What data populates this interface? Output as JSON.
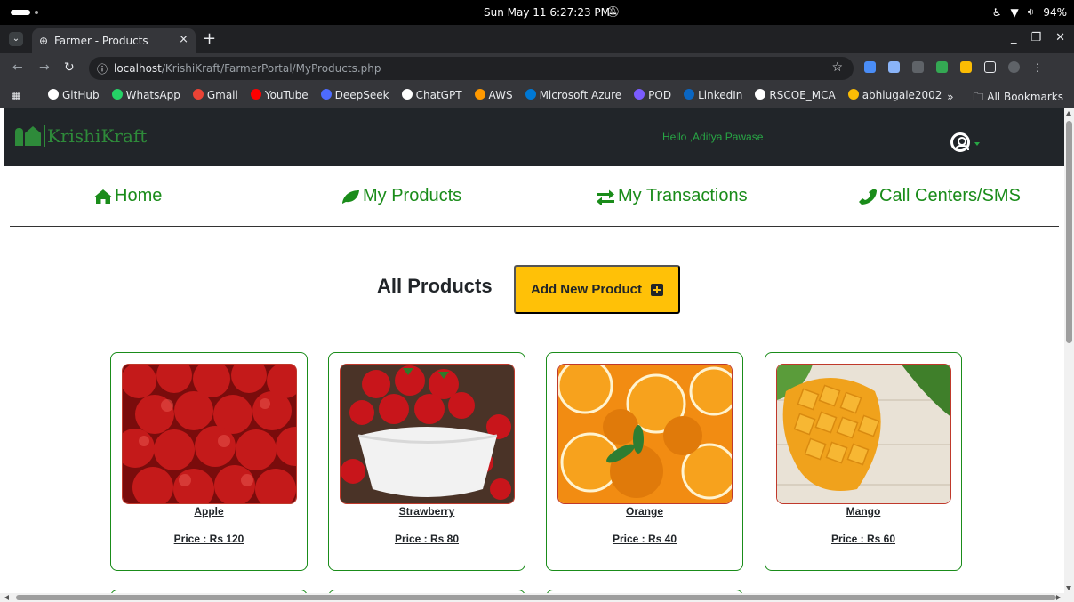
{
  "os": {
    "datetime": "Sun May 11   6:27:23 PM",
    "battery": "94%"
  },
  "browser": {
    "tab_title": "Farmer - Products",
    "tab_close": "×",
    "new_tab": "+",
    "url_host": "localhost",
    "url_path": "/KrishiKraft/FarmerPortal/MyProducts.php",
    "bookmarks": [
      {
        "label": "GitHub",
        "color": "#ffffff"
      },
      {
        "label": "WhatsApp",
        "color": "#25d366"
      },
      {
        "label": "Gmail",
        "color": "#ea4335"
      },
      {
        "label": "YouTube",
        "color": "#ff0000"
      },
      {
        "label": "DeepSeek",
        "color": "#4d6bfe"
      },
      {
        "label": "ChatGPT",
        "color": "#ffffff"
      },
      {
        "label": "AWS",
        "color": "#ff9900"
      },
      {
        "label": "Microsoft Azure",
        "color": "#0078d4"
      },
      {
        "label": "POD",
        "color": "#7b5cff"
      },
      {
        "label": "LinkedIn",
        "color": "#0a66c2"
      },
      {
        "label": "RSCOE_MCA",
        "color": "#ffffff"
      },
      {
        "label": "abhiugale2002",
        "color": "#fbbc04"
      }
    ],
    "bookmarks_overflow": "»",
    "all_bookmarks": "All Bookmarks"
  },
  "site": {
    "logo_text": "KrishiKraft",
    "greeting": "Hello ,Aditya Pawase",
    "accent": "#1a8c1a",
    "header_bg": "#212529"
  },
  "nav": {
    "home": "Home",
    "products": "My Products",
    "transactions": "My Transactions",
    "call_centers": "Call Centers/SMS"
  },
  "main": {
    "title": "All Products",
    "add_button": "Add New Product",
    "products": [
      {
        "name": "Apple",
        "price": "Price : Rs 120"
      },
      {
        "name": "Strawberry",
        "price": "Price : Rs 80"
      },
      {
        "name": "Orange",
        "price": "Price : Rs 40"
      },
      {
        "name": "Mango",
        "price": "Price : Rs 60"
      }
    ]
  }
}
